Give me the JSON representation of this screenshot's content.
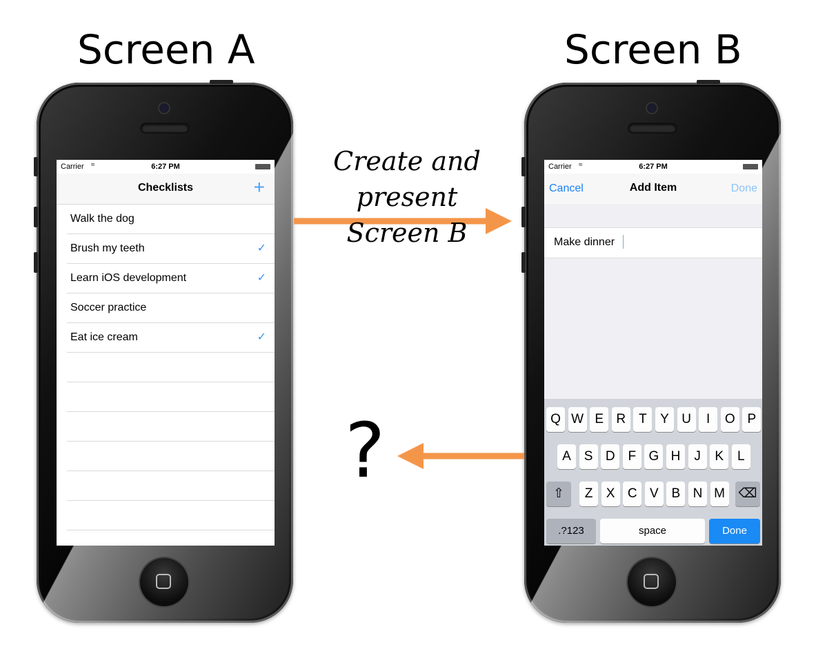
{
  "screen_a": {
    "title": "Screen A",
    "status": {
      "carrier": "Carrier",
      "time": "6:27 PM"
    },
    "nav_title": "Checklists",
    "add_icon": "plus-icon",
    "items": [
      {
        "label": "Walk the dog",
        "checked": false
      },
      {
        "label": "Brush my teeth",
        "checked": true
      },
      {
        "label": "Learn iOS development",
        "checked": true
      },
      {
        "label": "Soccer practice",
        "checked": false
      },
      {
        "label": "Eat ice cream",
        "checked": true
      },
      {
        "label": "",
        "checked": false
      },
      {
        "label": "",
        "checked": false
      },
      {
        "label": "",
        "checked": false
      },
      {
        "label": "",
        "checked": false
      },
      {
        "label": "",
        "checked": false
      },
      {
        "label": "",
        "checked": false
      }
    ]
  },
  "screen_b": {
    "title": "Screen B",
    "status": {
      "carrier": "Carrier",
      "time": "6:27 PM"
    },
    "nav": {
      "cancel": "Cancel",
      "title": "Add Item",
      "done": "Done"
    },
    "text_field_value": "Make dinner",
    "keyboard": {
      "row1": [
        "Q",
        "W",
        "E",
        "R",
        "T",
        "Y",
        "U",
        "I",
        "O",
        "P"
      ],
      "row2": [
        "A",
        "S",
        "D",
        "F",
        "G",
        "H",
        "J",
        "K",
        "L"
      ],
      "row3": [
        "Z",
        "X",
        "C",
        "V",
        "B",
        "N",
        "M"
      ],
      "shift_icon": "shift-icon",
      "delete_icon": "backspace-icon",
      "numbers_key": ".?123",
      "space_key": "space",
      "return_key": "Done"
    }
  },
  "arrow_forward_label": {
    "line1": "Create and present",
    "line2": "Screen B"
  },
  "arrow_back_label": "?",
  "colors": {
    "arrow": "#f4964a",
    "ios_blue": "#1a82f7",
    "checkmark": "#3a94f5"
  }
}
